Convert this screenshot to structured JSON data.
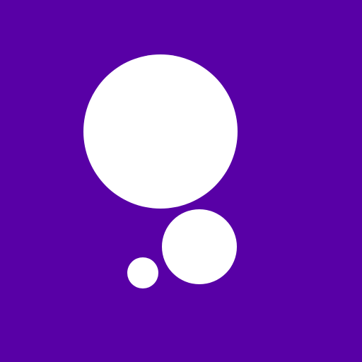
{
  "colors": {
    "background": "#5800A6",
    "circle_fill": "#FFFFFF"
  },
  "icon": {
    "name": "three-circles-bubbles-icon"
  }
}
